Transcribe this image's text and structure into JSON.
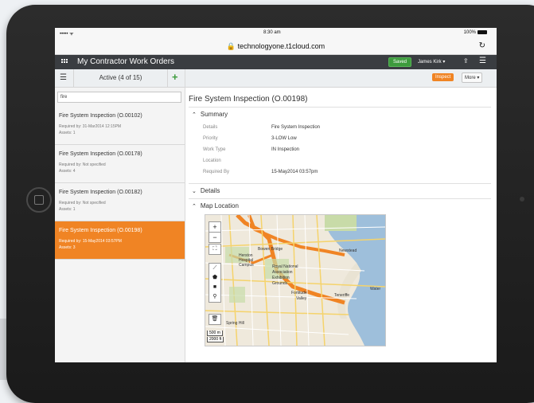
{
  "device": {
    "status": {
      "signal": "••••• ᯤ",
      "time": "8:30 am",
      "battery": "100%"
    },
    "url": "technologyone.t1cloud.com"
  },
  "app": {
    "title": "My Contractor Work Orders",
    "saved": "Saved",
    "user": "James Kirk ▾"
  },
  "list": {
    "header": "Active (4 of 15)",
    "search_value": "fire",
    "items": [
      {
        "title": "Fire System Inspection (O.00102)",
        "required": "Required by: 31-Mar2014 12:15PM",
        "assets": "Assets: 1"
      },
      {
        "title": "Fire System Inspection (O.00178)",
        "required": "Required by: Not specified",
        "assets": "Assets: 4"
      },
      {
        "title": "Fire System Inspection (O.00182)",
        "required": "Required by: Not specified",
        "assets": "Assets: 1"
      },
      {
        "title": "Fire System Inspection (O.00198)",
        "required": "Required by: 15-May2014 03:57PM",
        "assets": "Assets: 3"
      }
    ]
  },
  "detail": {
    "title": "Fire System Inspection (O.00198)",
    "inspect_label": "Inspect",
    "more_label": "More ▾",
    "summary": {
      "heading": "Summary",
      "rows": [
        {
          "label": "Details",
          "value": "Fire System Inspection"
        },
        {
          "label": "Priority",
          "value": "3-LOW  Low"
        },
        {
          "label": "Work Type",
          "value": "IN  Inspection"
        },
        {
          "label": "Location",
          "value": ""
        },
        {
          "label": "Required By",
          "value": "15-May2014 03:57pm"
        }
      ]
    },
    "details_heading": "Details",
    "map_heading": "Map Location",
    "map": {
      "labels": [
        "Bowen Bridge",
        "Newstead",
        "Herston",
        "Hospital",
        "Campus",
        "Royal National",
        "Association",
        "Exhibition",
        "Grounds",
        "Fortitude",
        "Valley",
        "Teneriffe",
        "Spring Hill",
        "Water"
      ],
      "scale_m": "500 m",
      "scale_ft": "2000 ft"
    }
  },
  "colors": {
    "accent": "#f08424",
    "saved": "#3d9b3d",
    "header": "#3a3d41"
  }
}
